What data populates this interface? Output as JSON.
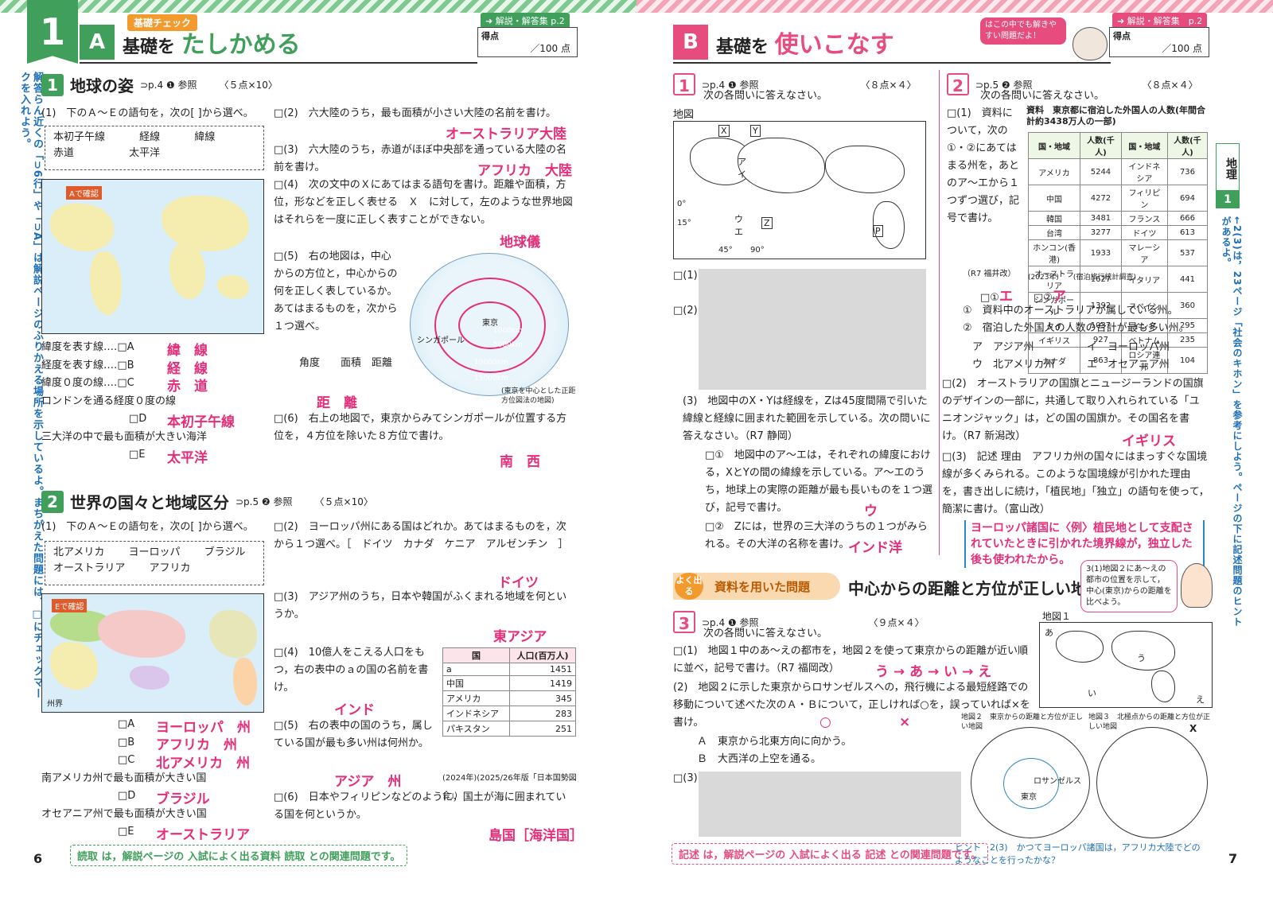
{
  "left": {
    "unit_number": "1",
    "section_label": "基礎チェック",
    "section_letter": "A",
    "section_title_pre": "基礎を",
    "section_title_big": "たしかめる",
    "ref": "➜ 解説・解答集 p.2",
    "score_label": "得点",
    "score_total": "／100 点",
    "side_note": "解答らん近くの「⊃6行」や「⊃A」は解説ページのふりかえる場所を示しているよ。まちがえた問題には、□にチェックマークを入れよう。",
    "q1": {
      "num": "1",
      "title": "地球の姿",
      "ref": "⊃p.4 ❶ 参照",
      "points": "〈５点×10〉",
      "s1": "(1)　下のＡ～Ｅの語句を，次の[  ]から選べ。",
      "choices": [
        "本初子午線",
        "経線",
        "緯線",
        "赤道",
        "太平洋"
      ],
      "map_note": "Aで確認",
      "lines": [
        "緯度を表す線‥‥□A",
        "経度を表す線‥‥□B",
        "緯度０度の線‥‥□C",
        "ロンドンを通る経度０度の線",
        "□D",
        "三大洋の中で最も面積が大きい海洋",
        "□E"
      ],
      "answers": [
        "緯　線",
        "経　線",
        "赤　道",
        "本初子午線",
        "太平洋"
      ],
      "s2": "□(2)　六大陸のうち，最も面積が小さい大陸の名前を書け。",
      "a2": "オーストラリア大陸",
      "s3": "□(3)　六大陸のうち，赤道がほぼ中央部を通っている大陸の名前を書け。",
      "a3": "アフリカ　大陸",
      "s4": "□(4)　次の文中のＸにあてはまる語句を書け。距離や面積，方位，形などを正しく表せる　Ｘ　に対して，左のような世界地図はそれらを一度に正しく表すことができない。",
      "a4": "地球儀",
      "s5": "□(5)　右の地図は，中心からの方位と，中心からの何を正しく表しているか。あてはまるものを，次から１つ選べ。",
      "s5c": "角度　　面積　距離",
      "a5": "距　離",
      "s6": "□(6)　右上の地図で，東京からみてシンガポールが位置する方位を，４方位を除いた８方位で書け。",
      "a6": "南　西",
      "globe_caption": "(東京を中心とした正距方位図法の地図)",
      "globe_labels": [
        "東京",
        "シンガポール",
        "1000km",
        "5000km",
        "10000km",
        "15000km"
      ]
    },
    "q2": {
      "num": "2",
      "title": "世界の国々と地域区分",
      "ref": "⊃p.5 ❷ 参照",
      "points": "〈５点×10〉",
      "s1": "(1)　下のＡ～Ｅの語句を，次の[  ]から選べ。",
      "choices": [
        "北アメリカ",
        "ヨーロッパ",
        "ブラジル",
        "オーストラリア",
        "アフリカ"
      ],
      "map_note": "Eで確認",
      "map_legend": "州界",
      "lines": [
        "□A",
        "□B",
        "□C",
        "南アメリカ州で最も面積が大きい国",
        "□D",
        "オセアニア州で最も面積が大きい国",
        "□E"
      ],
      "answers": [
        "ヨーロッパ　州",
        "アフリカ　州",
        "北アメリカ　州",
        "ブラジル",
        "オーストラリア"
      ],
      "s2": "□(2)　ヨーロッパ州にある国はどれか。あてはまるものを，次から１つ選べ。［　ドイツ　カナダ　ケニア　アルゼンチン　］",
      "a2": "ドイツ",
      "s3": "□(3)　アジア州のうち，日本や韓国がふくまれる地域を何というか。",
      "a3": "東アジア",
      "s4": "□(4)　10億人をこえる人口をもつ，右の表中のａの国の名前を書け。",
      "a4": "インド",
      "s5": "□(5)　右の表中の国のうち，属している国が最も多い州は何州か。",
      "a5": "アジア　州",
      "s6": "□(6)　日本やフィリピンなどのように，国土が海に囲まれている国を何というか。",
      "a6": "島国［海洋国］",
      "table_head": [
        "国",
        "人口(百万人)"
      ],
      "table_rows": [
        [
          "a",
          "1451"
        ],
        [
          "中国",
          "1419"
        ],
        [
          "アメリカ",
          "345"
        ],
        [
          "インドネシア",
          "283"
        ],
        [
          "パキスタン",
          "251"
        ]
      ],
      "table_src": "(2024年)(2025/26年版「日本国勢図会」)"
    },
    "footer": "読取 は，解説ページの 入試によく出る資料 読取 との関連問題です。",
    "page": "6"
  },
  "right": {
    "section_letter": "B",
    "section_title_pre": "基礎を",
    "section_title_big": "使いこなす",
    "bubble": "はこの中でも解きやすい問題だよ！",
    "ref": "➜ 解説・解答集　p.2",
    "score_label": "得点",
    "score_total": "／100 点",
    "side_tab": "地理",
    "side_tab_num": "1",
    "side_note": "←2(3)は，23ページ「社会のキホン」を参考にしよう。ページの下に記述問題のヒントがあるよ。",
    "q1": {
      "num": "1",
      "ref": "⊃p.4 ❶ 参照",
      "points": "〈８点×４〉",
      "intro": "次の各問いに答えなさい。",
      "map_title": "地図",
      "map_labels": [
        "X",
        "Y",
        "ア",
        "イ",
        "ウ",
        "エ",
        "Z",
        "P",
        "45°",
        "90°",
        "0°",
        "15°"
      ],
      "s1": "□(1)",
      "s2": "□(2)",
      "s3": "(3)　地図中のX・Yは経線を，Zは45度間隔で引いた緯線と経線に囲まれた範囲を示している。次の問いに答えなさい。（R7 静岡）",
      "s3a": "□①　地図中のア～エは，それぞれの緯度における，XとYの間の緯線を示している。ア～エのうち，地球上の実際の距離が最も長いものを１つ選び，記号で書け。",
      "a3a": "ウ",
      "s3b": "□②　Zには，世界の三大洋のうちの１つがみられる。その大洋の名称を書け。",
      "a3b": "インド洋"
    },
    "q2": {
      "num": "2",
      "ref": "⊃p.5 ❷ 参照",
      "points": "〈８点×４〉",
      "intro": "次の各問いに答えなさい。",
      "s1": "□(1)　資料について，次の①・②にあてはまる州を，あとのア～エから１つずつ選び，記号で書け。",
      "source": "（R7 福井改）",
      "table_title": "資料　東京都に宿泊した外国人の人数(年間合計約3438万人の一部)",
      "table_head": [
        "国・地域",
        "人数(千人)",
        "国・地域",
        "人数(千人)"
      ],
      "table_rows": [
        [
          "アメリカ",
          "5244",
          "インドネシア",
          "736"
        ],
        [
          "中国",
          "4272",
          "フィリピン",
          "694"
        ],
        [
          "韓国",
          "3481",
          "フランス",
          "666"
        ],
        [
          "台湾",
          "3277",
          "ドイツ",
          "613"
        ],
        [
          "ホンコン(香港)",
          "1933",
          "マレーシア",
          "537"
        ],
        [
          "オーストラリア",
          "1627",
          "イタリア",
          "441"
        ],
        [
          "シンガポール",
          "1392",
          "スペイン",
          "360"
        ],
        [
          "タイ",
          "1037",
          "インド",
          "295"
        ],
        [
          "イギリス",
          "927",
          "ベトナム",
          "235"
        ],
        [
          "カナダ",
          "863",
          "ロシア連邦",
          "104"
        ]
      ],
      "table_src": "(2023年)　　(宿泊旅行統計調査)",
      "a1": "エ",
      "a2": "ア",
      "sub1": "①　資料中のオーストラリアが属している州。",
      "sub2": "②　宿泊した外国人の人数の合計が最も多い州。",
      "opts": [
        "ア　アジア州",
        "イ　ヨーロッパ州",
        "ウ　北アメリカ州",
        "エ　オセアニア州"
      ],
      "s2": "□(2)　オーストラリアの国旗とニュージーランドの国旗のデザインの一部に，共通して取り入れられている「ユニオンジャック」は，どの国の国旗か。その国名を書け。（R7 新潟改）",
      "a2b": "イギリス",
      "s3": "□(3)　記述 理由　アフリカ州の国々にはまっすぐな国境線が多くみられる。このような国境線が引かれた理由を，書き出しに続け，「植民地」「独立」の語句を使って，簡潔に書け。（富山改）",
      "a3": "ヨーロッパ諸国に〈例〉植民地として支配されていたときに引かれた境界線が，独立した後も使われたから。"
    },
    "q3": {
      "banner": "よく出る",
      "banner_label": "資料を用いた問題",
      "banner_title": "中心からの距離と方位が正しい地図",
      "balloon": "3(1)地図２にあ～えの都市の位置を示して，中心(東京)からの距離を比べよう。",
      "num": "3",
      "ref": "⊃p.4 ❶ 参照",
      "points": "〈９点×４〉",
      "intro": "次の各問いに答えなさい。",
      "s1": "□(1)　地図１中のあ～えの都市を，地図２を使って東京からの距離が近い順に並べ，記号で書け。（R7 福岡改）",
      "a1": "う → あ → い → え",
      "s2": "(2)　地図２に示した東京からロサンゼルスへの，飛行機による最短経路での移動について述べた次のＡ・Ｂについて，正しければ○を，誤っていれば×を書け。",
      "a2a": "○",
      "a2b": "×",
      "s2a": "Ａ　東京から北東方向に向かう。",
      "s2b": "Ｂ　大西洋の上空を通る。",
      "s3": "□(3)",
      "map1": "地図１",
      "map2": "地図２　東京からの距離と方位が正しい地図",
      "map3": "地図３　北極点からの距離と方位が正しい地図",
      "map_labels": [
        "あ",
        "い",
        "う",
        "え",
        "ロサンゼルス",
        "東京",
        "X"
      ]
    },
    "footer": "記述 は，解説ページの 入試によく出る 記述 との関連問題です。",
    "hint": "ヒント　2(3)　かつてヨーロッパ諸国は，アフリカ大陸でどのようなことを行ったかな？",
    "page": "7"
  }
}
